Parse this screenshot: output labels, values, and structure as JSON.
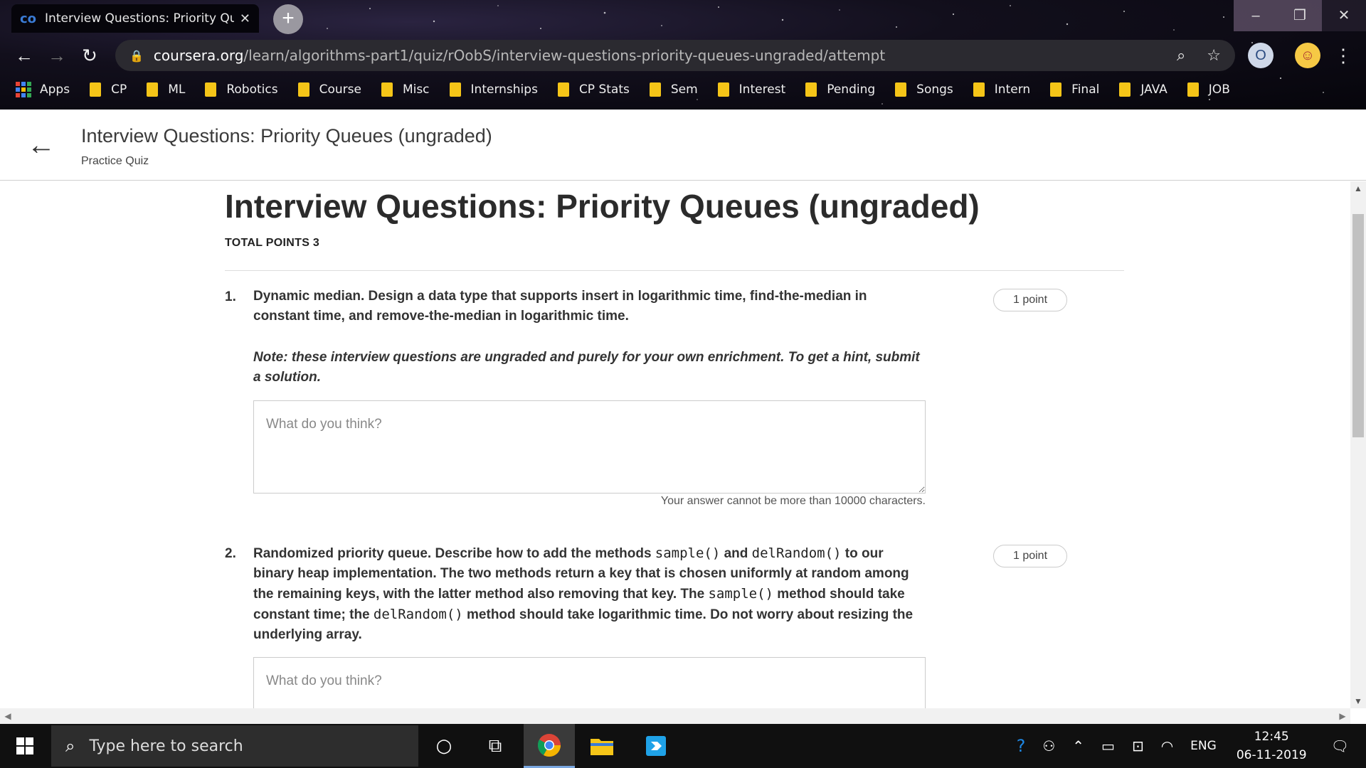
{
  "browser": {
    "tab": {
      "title": "Interview Questions: Priority Que",
      "favicon": "coursera-icon"
    },
    "address": {
      "host": "coursera.org",
      "path": "/learn/algorithms-part1/quiz/rOobS/interview-questions-priority-queues-ungraded/attempt"
    },
    "bookmarks": [
      {
        "label": "Apps",
        "icon": "apps-grid-icon"
      },
      {
        "label": "CP",
        "icon": "folder-icon"
      },
      {
        "label": "ML",
        "icon": "folder-icon"
      },
      {
        "label": "Robotics",
        "icon": "folder-icon"
      },
      {
        "label": "Course",
        "icon": "folder-icon"
      },
      {
        "label": "Misc",
        "icon": "folder-icon"
      },
      {
        "label": "Internships",
        "icon": "folder-icon"
      },
      {
        "label": "CP Stats",
        "icon": "folder-icon"
      },
      {
        "label": "Sem",
        "icon": "folder-icon"
      },
      {
        "label": "Interest",
        "icon": "folder-icon"
      },
      {
        "label": "Pending",
        "icon": "folder-icon"
      },
      {
        "label": "Songs",
        "icon": "folder-icon"
      },
      {
        "label": "Intern",
        "icon": "folder-icon"
      },
      {
        "label": "Final",
        "icon": "folder-icon"
      },
      {
        "label": "JAVA",
        "icon": "folder-icon"
      },
      {
        "label": "JOB",
        "icon": "folder-icon"
      }
    ]
  },
  "header": {
    "title": "Interview Questions: Priority Queues (ungraded)",
    "subtitle": "Practice Quiz"
  },
  "quiz": {
    "title": "Interview Questions: Priority Queues (ungraded)",
    "total_points": "TOTAL POINTS 3",
    "questions": [
      {
        "number": "1.",
        "text": "Dynamic median. Design a data type that supports insert in logarithmic time, find-the-median in constant time, and remove-the-median in logarithmic time.",
        "note": "Note: these interview questions are ungraded and purely for your own enrichment. To get a hint, submit a solution.",
        "points": "1 point",
        "placeholder": "What do you think?",
        "limit_note": "Your answer cannot be more than 10000 characters."
      },
      {
        "number": "2.",
        "text_parts": {
          "a": "Randomized priority queue. Describe how to add the methods ",
          "code1": "sample()",
          "b": " and ",
          "code2": "delRandom()",
          "c": " to our binary heap implementation. The two methods return a key that is chosen uniformly at random among the remaining keys, with the latter method also removing that key. The ",
          "code3": "sample()",
          "d": " method should take constant time; the ",
          "code4": "delRandom()",
          "e": " method should take logarithmic time. Do not worry about resizing the underlying array."
        },
        "points": "1 point",
        "placeholder": "What do you think?"
      }
    ]
  },
  "taskbar": {
    "search_placeholder": "Type here to search",
    "language": "ENG",
    "time": "12:45",
    "date": "06-11-2019"
  },
  "colors": {
    "folder": "#f5c518",
    "taskbar": "#101010",
    "omnibox": "#2b2a30"
  }
}
